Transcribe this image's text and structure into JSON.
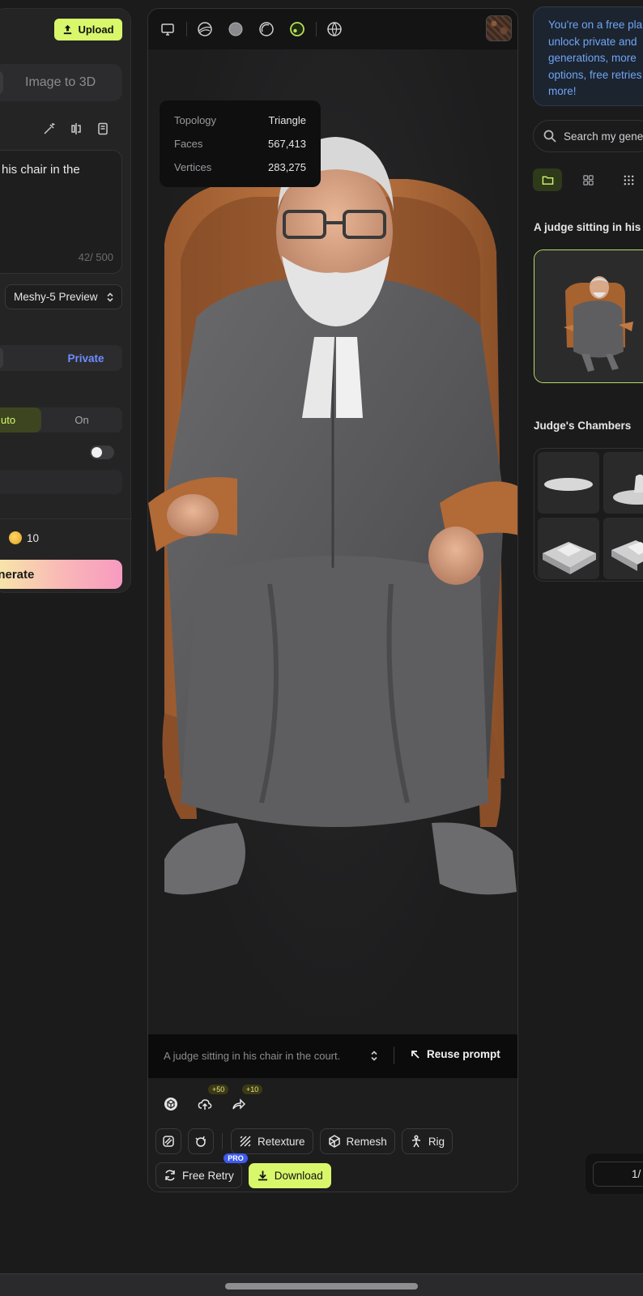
{
  "left_panel": {
    "upload_label": "Upload",
    "mode_tab": "Image to 3D",
    "prompt_text": "his chair in the",
    "char_count": "42/ 500",
    "model_select": "Meshy-5 Preview",
    "visibility_private": "Private",
    "toggle_auto": "uto",
    "toggle_on": "On",
    "credits": "10",
    "generate_label": "enerate"
  },
  "viewer": {
    "stats": [
      {
        "label": "Topology",
        "value": "Triangle"
      },
      {
        "label": "Faces",
        "value": "567,413"
      },
      {
        "label": "Vertices",
        "value": "283,275"
      }
    ],
    "toolbar_icons": [
      "monitor-icon",
      "wireframe-shading-icon",
      "clay-shading-icon",
      "outline-shading-icon",
      "textured-shading-icon",
      "environment-globe-icon"
    ],
    "prompt": "A judge sitting in his chair in the court.",
    "reuse_label": "Reuse prompt",
    "upload_bonus": "+50",
    "share_bonus": "+10",
    "retexture_label": "Retexture",
    "remesh_label": "Remesh",
    "rig_label": "Rig",
    "free_retry_label": "Free Retry",
    "pro_label": "PRO",
    "download_label": "Download"
  },
  "right_panel": {
    "promo_lines": [
      "You're on a free pla",
      "unlock private and",
      "generations, more",
      "options, free retries",
      "more!"
    ],
    "search_placeholder": "Search my gene",
    "recent_title": "A judge sitting in his c",
    "collection_title": "Judge's Chambers",
    "pager_text": "1/"
  },
  "colors": {
    "accent": "#d8f76b",
    "private_blue": "#6d8cff",
    "promo_blue": "#6fa5f5",
    "pro_badge": "#3d5bf0"
  }
}
